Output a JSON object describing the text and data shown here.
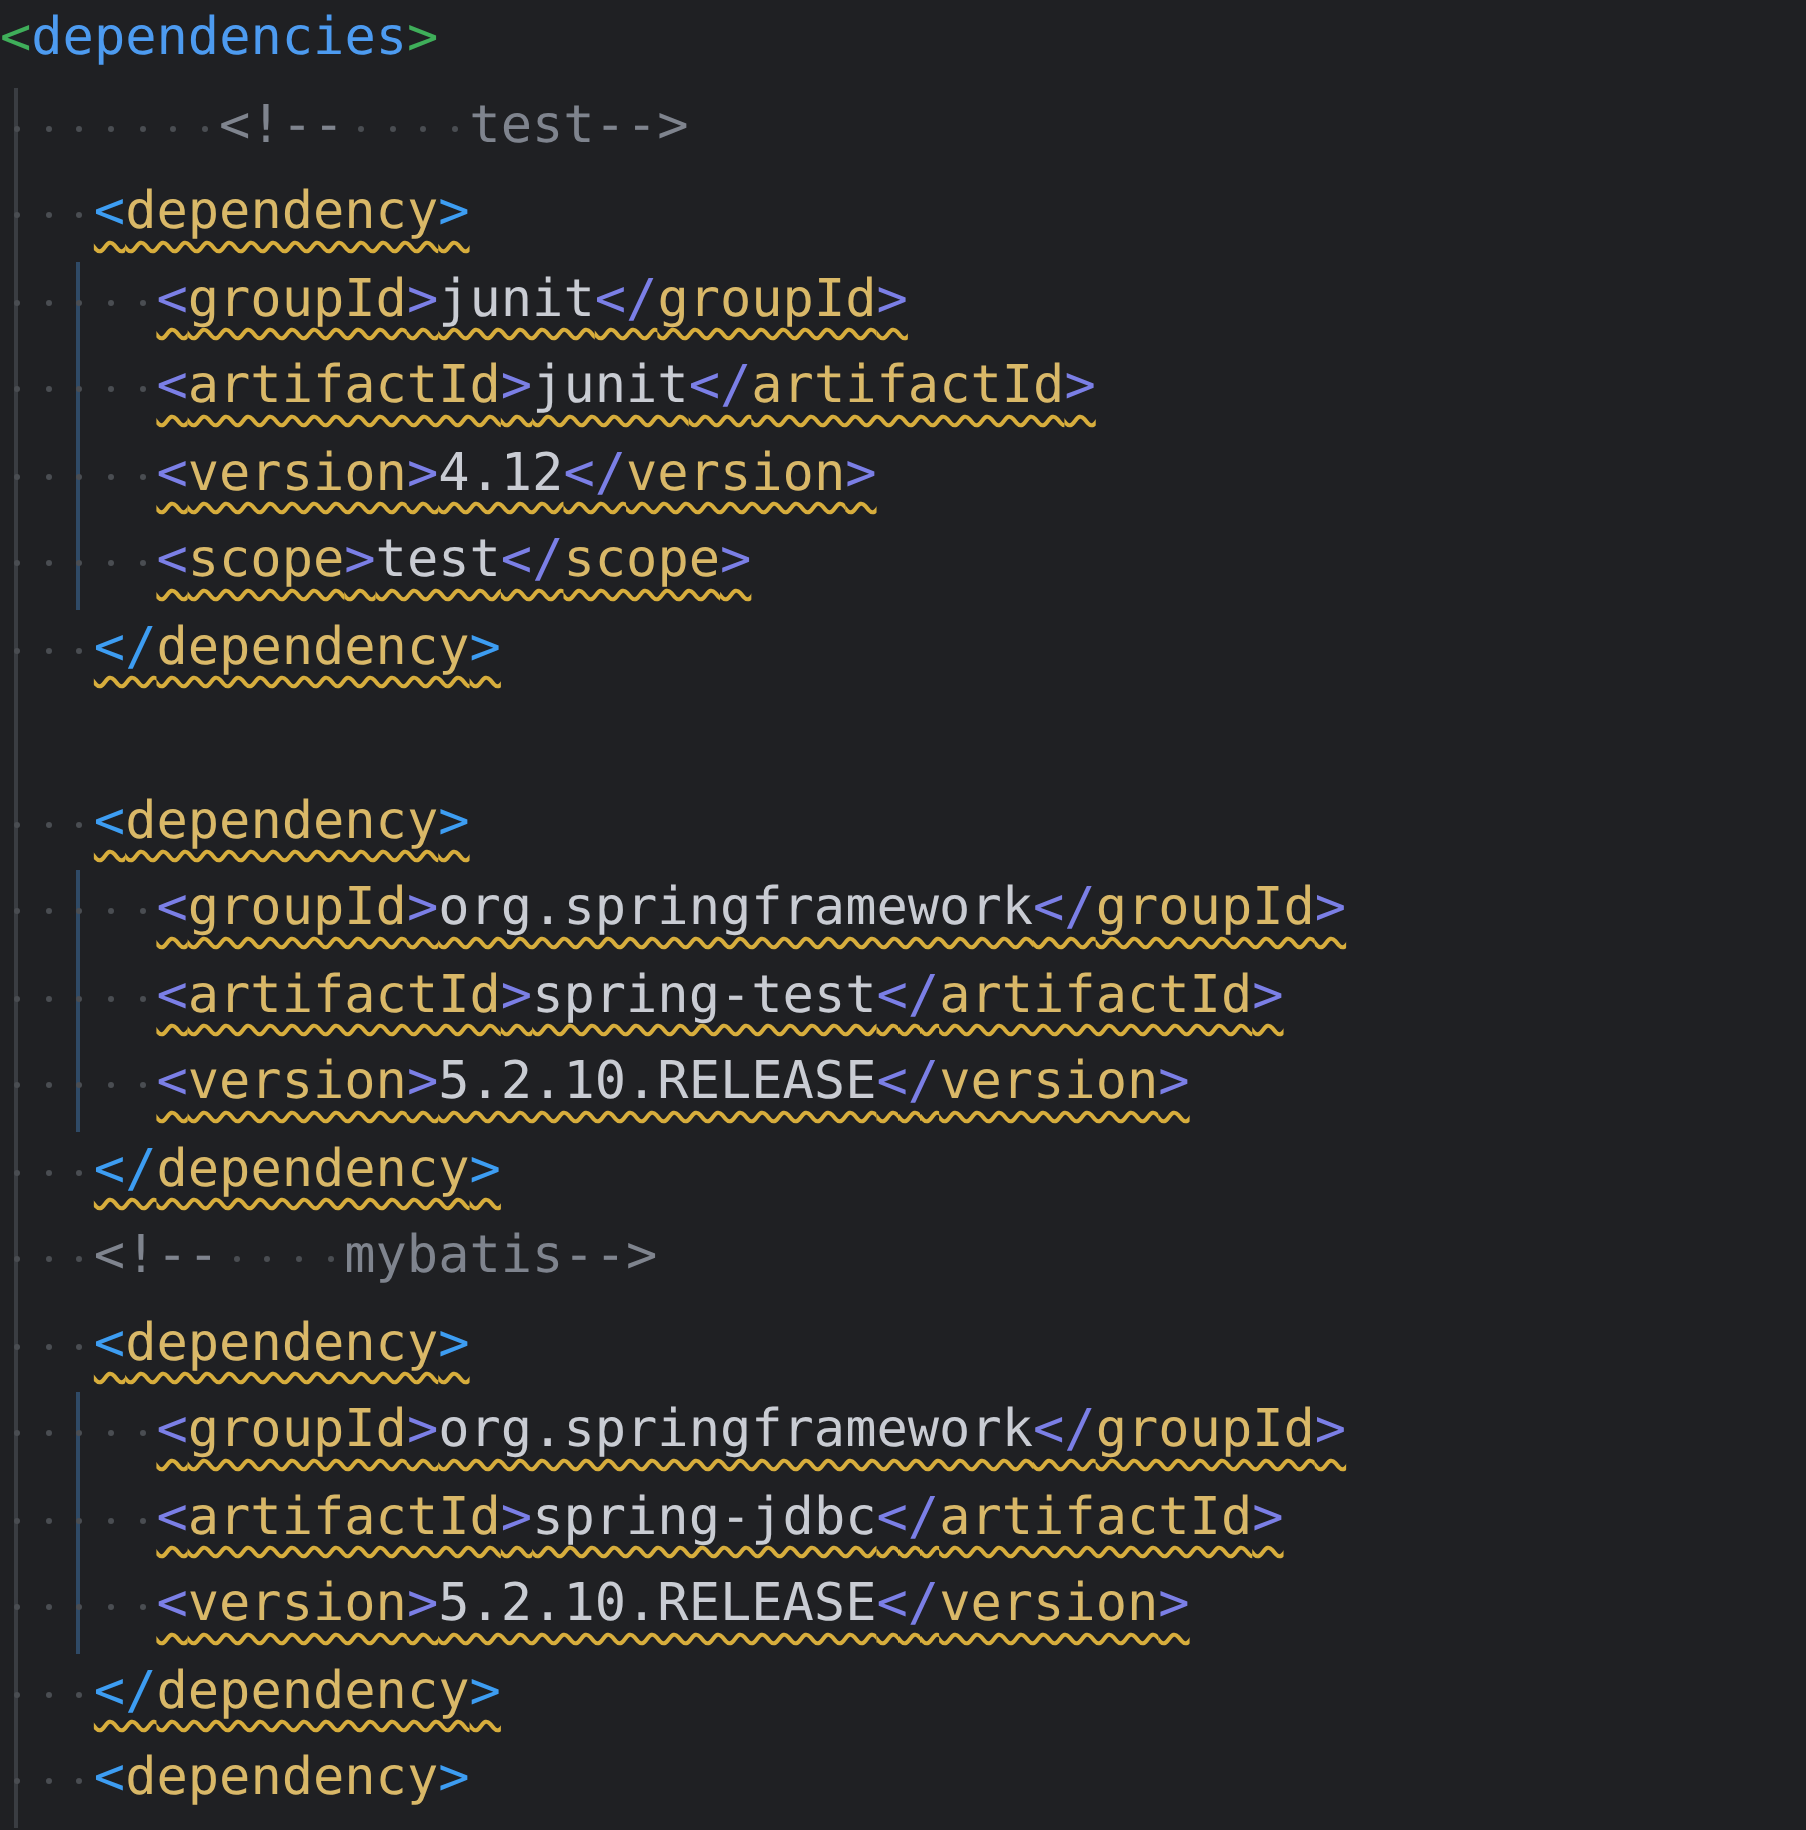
{
  "editor": {
    "lines": [
      {
        "kind": "tag",
        "text": "<dependencies>",
        "warning": false
      },
      {
        "kind": "comment",
        "text": "       <!--    test-->",
        "warning": false
      },
      {
        "kind": "tag",
        "text": "   <dependency>",
        "warning": true
      },
      {
        "kind": "tag",
        "text": "     <groupId>junit</groupId>",
        "warning": true
      },
      {
        "kind": "tag",
        "text": "     <artifactId>junit</artifactId>",
        "warning": true
      },
      {
        "kind": "tag",
        "text": "     <version>4.12</version>",
        "warning": true
      },
      {
        "kind": "tag",
        "text": "     <scope>test</scope>",
        "warning": true
      },
      {
        "kind": "tag",
        "text": "   </dependency>",
        "warning": true
      },
      {
        "kind": "blank"
      },
      {
        "kind": "tag",
        "text": "   <dependency>",
        "warning": true
      },
      {
        "kind": "tag",
        "text": "     <groupId>org.springframework</groupId>",
        "warning": true
      },
      {
        "kind": "tag",
        "text": "     <artifactId>spring-test</artifactId>",
        "warning": true
      },
      {
        "kind": "tag",
        "text": "     <version>5.2.10.RELEASE</version>",
        "warning": true
      },
      {
        "kind": "tag",
        "text": "   </dependency>",
        "warning": true
      },
      {
        "kind": "comment",
        "text": "   <!--    mybatis-->",
        "warning": false
      },
      {
        "kind": "tag",
        "text": "   <dependency>",
        "warning": true
      },
      {
        "kind": "tag",
        "text": "     <groupId>org.springframework</groupId>",
        "warning": true
      },
      {
        "kind": "tag",
        "text": "     <artifactId>spring-jdbc</artifactId>",
        "warning": true
      },
      {
        "kind": "tag",
        "text": "     <version>5.2.10.RELEASE</version>",
        "warning": true
      },
      {
        "kind": "tag",
        "text": "   </dependency>",
        "warning": true
      },
      {
        "kind": "tag",
        "text": "   <dependency>",
        "warning": false
      }
    ]
  }
}
